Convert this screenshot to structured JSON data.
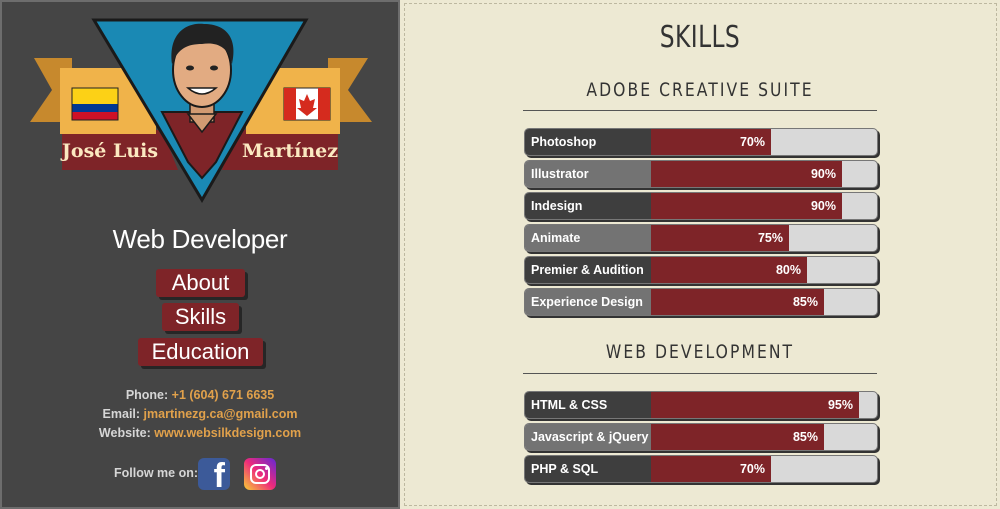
{
  "profile": {
    "first_name": "José Luis",
    "last_name": "Martínez",
    "job_title": "Web Developer"
  },
  "nav": {
    "about": "About",
    "skills": "Skills",
    "education": "Education"
  },
  "contact": {
    "phone_label": "Phone:",
    "phone": "+1 (604) 671 6635",
    "email_label": "Email:",
    "email": "jmartinezg.ca@gmail.com",
    "website_label": "Website:",
    "website": "www.websilkdesign.com",
    "follow_label": "Follow me on:",
    "social_icons": [
      "facebook-icon",
      "instagram-icon"
    ]
  },
  "skills": {
    "title": "SKILLS",
    "sections": [
      {
        "title": "ADOBE CREATIVE SUITE",
        "items": [
          {
            "label": "Photoshop",
            "percent": 70,
            "pct_text": "70%"
          },
          {
            "label": "Illustrator",
            "percent": 90,
            "pct_text": "90%"
          },
          {
            "label": "Indesign",
            "percent": 90,
            "pct_text": "90%"
          },
          {
            "label": "Animate",
            "percent": 75,
            "pct_text": "75%"
          },
          {
            "label": "Premier & Audition",
            "percent": 80,
            "pct_text": "80%"
          },
          {
            "label": "Experience Design",
            "percent": 85,
            "pct_text": "85%"
          }
        ]
      },
      {
        "title": "WEB DEVELOPMENT",
        "items": [
          {
            "label": "HTML & CSS",
            "percent": 95,
            "pct_text": "95%"
          },
          {
            "label": "Javascript & jQuery",
            "percent": 85,
            "pct_text": "85%"
          },
          {
            "label": "PHP & SQL",
            "percent": 70,
            "pct_text": "70%"
          }
        ]
      }
    ]
  },
  "colors": {
    "sidebar_bg": "#454545",
    "accent_red": "#7e2428",
    "link_orange": "#e1a14b",
    "page_bg": "#ede9d3",
    "ribbon_gold": "#e9a93f",
    "triangle_blue": "#1a89b4"
  }
}
